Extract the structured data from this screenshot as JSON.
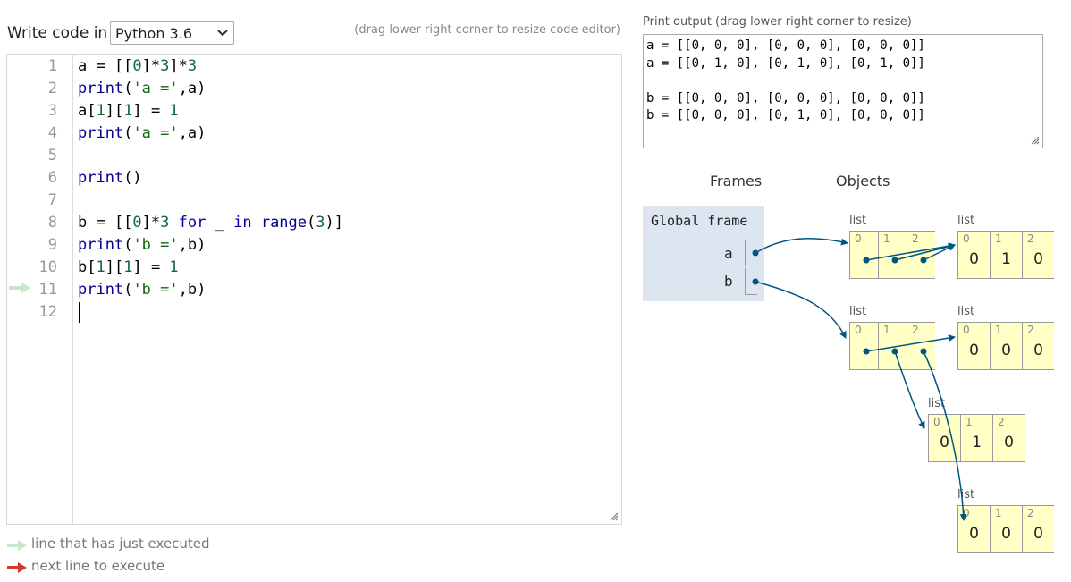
{
  "header": {
    "write_label": "Write code in",
    "language": "Python 3.6",
    "resize_hint": "(drag lower right corner to resize code editor)"
  },
  "editor": {
    "line_numbers": [
      "1",
      "2",
      "3",
      "4",
      "5",
      "6",
      "7",
      "8",
      "9",
      "10",
      "11",
      "12"
    ],
    "current_line": 11
  },
  "legend": {
    "executed": "line that has just executed",
    "next": "next line to execute",
    "executed_color": "#c9e6ca",
    "next_color": "#d33a2a"
  },
  "output": {
    "label": "Print output (drag lower right corner to resize)",
    "lines": [
      "a = [[0, 0, 0], [0, 0, 0], [0, 0, 0]]",
      "a = [[0, 1, 0], [0, 1, 0], [0, 1, 0]]",
      "",
      "b = [[0, 0, 0], [0, 0, 0], [0, 0, 0]]",
      "b = [[0, 0, 0], [0, 1, 0], [0, 0, 0]]"
    ]
  },
  "viz": {
    "frames_header": "Frames",
    "objects_header": "Objects",
    "global_frame": "Global frame",
    "vars": [
      "a",
      "b"
    ],
    "list_label": "list",
    "index_labels": [
      "0",
      "1",
      "2"
    ],
    "int_lists": {
      "a_inner": [
        "0",
        "1",
        "0"
      ],
      "b_row0": [
        "0",
        "0",
        "0"
      ],
      "b_row1": [
        "0",
        "1",
        "0"
      ],
      "b_row2": [
        "0",
        "0",
        "0"
      ]
    },
    "pointer_color": "#005583",
    "object_bg": "#ffffc6",
    "frame_bg": "#dde6f0"
  }
}
